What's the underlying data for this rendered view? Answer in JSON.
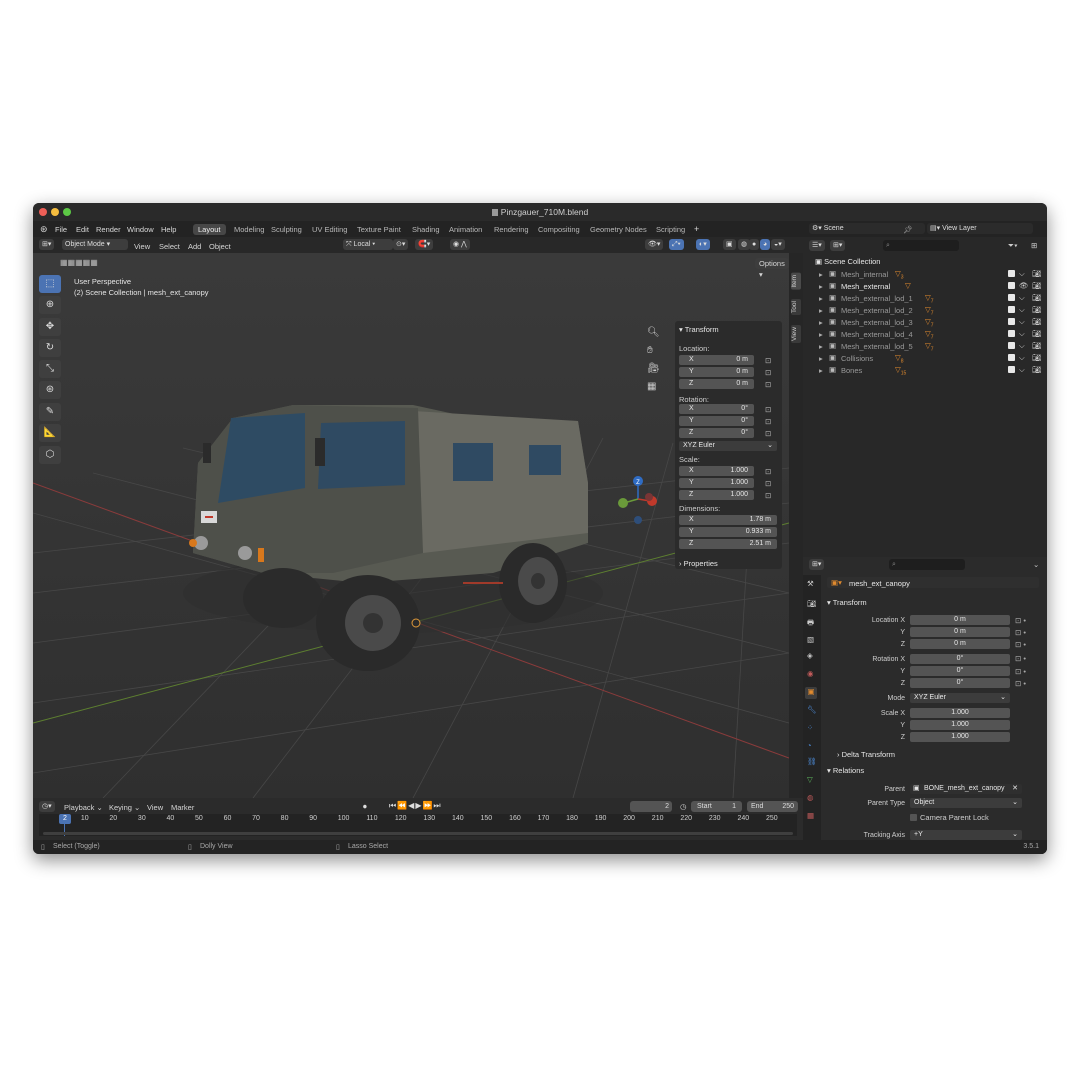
{
  "window": {
    "title": "Pinzgauer_710M.blend"
  },
  "menu": [
    "File",
    "Edit",
    "Render",
    "Window",
    "Help"
  ],
  "workspaces": [
    "Layout",
    "Modeling",
    "Sculpting",
    "UV Editing",
    "Texture Paint",
    "Shading",
    "Animation",
    "Rendering",
    "Compositing",
    "Geometry Nodes",
    "Scripting"
  ],
  "header": {
    "mode": "Object Mode",
    "view_menu": [
      "View",
      "Select",
      "Add",
      "Object"
    ],
    "orientation": "Local",
    "options": "Options"
  },
  "viewport": {
    "perspective": "User Perspective",
    "collection_info": "(2) Scene Collection | mesh_ext_canopy",
    "gizmo_z": "Z"
  },
  "npanel": {
    "transform_title": "Transform",
    "location_label": "Location:",
    "location": [
      {
        "axis": "X",
        "value": "0 m"
      },
      {
        "axis": "Y",
        "value": "0 m"
      },
      {
        "axis": "Z",
        "value": "0 m"
      }
    ],
    "rotation_label": "Rotation:",
    "rotation": [
      {
        "axis": "X",
        "value": "0°"
      },
      {
        "axis": "Y",
        "value": "0°"
      },
      {
        "axis": "Z",
        "value": "0°"
      }
    ],
    "rotation_mode": "XYZ Euler",
    "scale_label": "Scale:",
    "scale": [
      {
        "axis": "X",
        "value": "1.000"
      },
      {
        "axis": "Y",
        "value": "1.000"
      },
      {
        "axis": "Z",
        "value": "1.000"
      }
    ],
    "dimensions_label": "Dimensions:",
    "dimensions": [
      {
        "axis": "X",
        "value": "1.78 m"
      },
      {
        "axis": "Y",
        "value": "0.933 m"
      },
      {
        "axis": "Z",
        "value": "2.51 m"
      }
    ],
    "properties_label": "Properties",
    "tabs": [
      "Item",
      "Tool",
      "View"
    ]
  },
  "scene": {
    "name": "Scene",
    "view_layer": "View Layer"
  },
  "outliner": {
    "root": "Scene Collection",
    "items": [
      {
        "name": "Mesh_internal",
        "badge": "3",
        "active": false
      },
      {
        "name": "Mesh_external",
        "badge": "",
        "active": true
      },
      {
        "name": "Mesh_external_lod_1",
        "badge": "7",
        "active": false
      },
      {
        "name": "Mesh_external_lod_2",
        "badge": "7",
        "active": false
      },
      {
        "name": "Mesh_external_lod_3",
        "badge": "7",
        "active": false
      },
      {
        "name": "Mesh_external_lod_4",
        "badge": "7",
        "active": false
      },
      {
        "name": "Mesh_external_lod_5",
        "badge": "7",
        "active": false
      },
      {
        "name": "Collisions",
        "badge": "8",
        "active": false
      },
      {
        "name": "Bones",
        "badge": "15",
        "active": false
      }
    ]
  },
  "properties": {
    "object_name": "mesh_ext_canopy",
    "transform_title": "Transform",
    "location": [
      {
        "label": "Location X",
        "value": "0 m"
      },
      {
        "label": "Y",
        "value": "0 m"
      },
      {
        "label": "Z",
        "value": "0 m"
      }
    ],
    "rotation": [
      {
        "label": "Rotation X",
        "value": "0°"
      },
      {
        "label": "Y",
        "value": "0°"
      },
      {
        "label": "Z",
        "value": "0°"
      }
    ],
    "mode_label": "Mode",
    "mode_value": "XYZ Euler",
    "scale": [
      {
        "label": "Scale X",
        "value": "1.000"
      },
      {
        "label": "Y",
        "value": "1.000"
      },
      {
        "label": "Z",
        "value": "1.000"
      }
    ],
    "delta_transform": "Delta Transform",
    "relations_title": "Relations",
    "parent_label": "Parent",
    "parent_value": "BONE_mesh_ext_canopy",
    "parent_type_label": "Parent Type",
    "parent_type_value": "Object",
    "camera_parent_lock": "Camera Parent Lock",
    "tracking_axis_label": "Tracking Axis",
    "tracking_axis_value": "+Y"
  },
  "timeline": {
    "menus": [
      "Playback",
      "Keying",
      "View",
      "Marker"
    ],
    "current_frame": "2",
    "start_label": "Start",
    "start": "1",
    "end_label": "End",
    "end": "250",
    "ticks": [
      "10",
      "20",
      "30",
      "40",
      "50",
      "60",
      "70",
      "80",
      "90",
      "100",
      "110",
      "120",
      "130",
      "140",
      "150",
      "160",
      "170",
      "180",
      "190",
      "200",
      "210",
      "220",
      "230",
      "240",
      "250"
    ],
    "playhead": "2"
  },
  "status": {
    "left": "Select (Toggle)",
    "mid": "Dolly View",
    "right": "Lasso Select",
    "version": "3.5.1"
  },
  "colors": {
    "accent": "#4b73b3",
    "orange": "#e08a2e",
    "grid": "#4a4a4a",
    "x_axis": "#b94a4a",
    "y_axis": "#6a9a3a"
  }
}
